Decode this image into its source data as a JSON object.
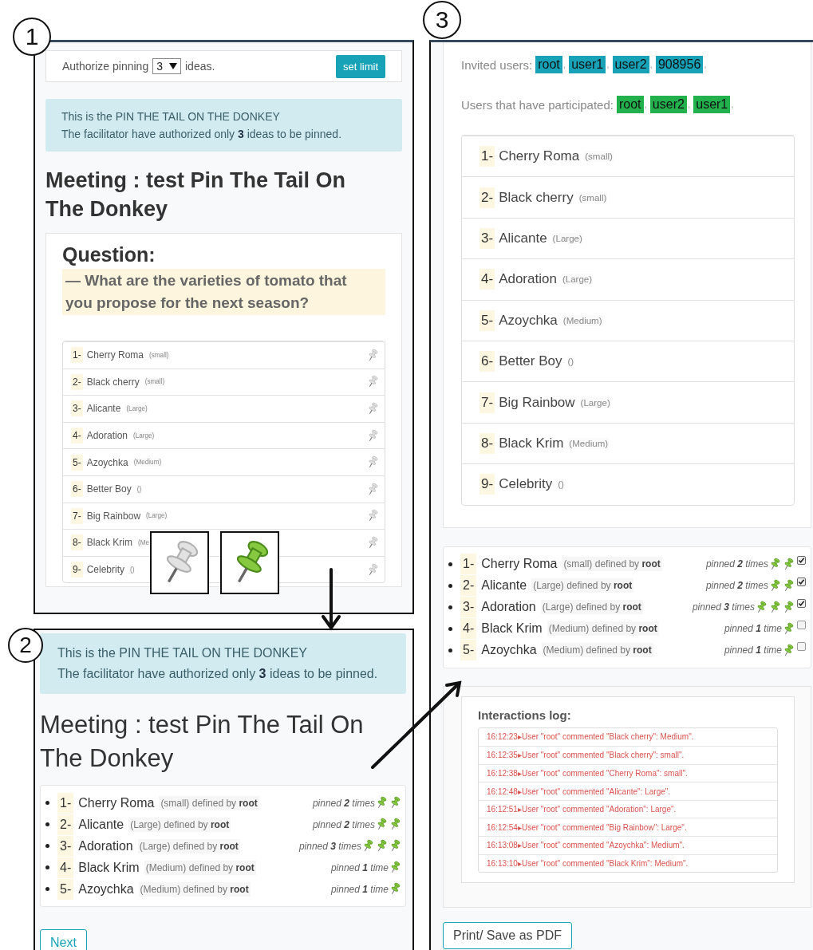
{
  "panel_1": {
    "marker": "1",
    "limit_bar": {
      "label": "Authorize pinning",
      "select_value": "3",
      "suffix": "ideas.",
      "button": "set limit"
    },
    "alert": {
      "lines": [
        "This is the PIN THE TAIL ON THE DONKEY",
        "The facilitator have authorized only **3** ideas to be pinned."
      ]
    },
    "title": "Meeting : test Pin The Tail On The Donkey",
    "question": {
      "heading": "Question:",
      "text": "— What are the varieties of tomato that you propose for the next season?"
    },
    "ideas": [
      {
        "number": "1-",
        "name": "Cherry Roma",
        "detail": "(small)"
      },
      {
        "number": "2-",
        "name": "Black cherry",
        "detail": "(small)"
      },
      {
        "number": "3-",
        "name": "Alicante",
        "detail": "(Large)"
      },
      {
        "number": "4-",
        "name": "Adoration",
        "detail": "(Large)"
      },
      {
        "number": "5-",
        "name": "Azoychka",
        "detail": "(Medium)"
      },
      {
        "number": "6-",
        "name": "Better Boy",
        "detail": "()"
      },
      {
        "number": "7-",
        "name": "Big Rainbow",
        "detail": "(Large)"
      },
      {
        "number": "8-",
        "name": "Black Krim",
        "detail": "(Me"
      },
      {
        "number": "9-",
        "name": "Celebrity",
        "detail": "()"
      }
    ],
    "legend": [
      {
        "kind": "unpinned"
      },
      {
        "kind": "pinned"
      }
    ]
  },
  "panel_2": {
    "marker": "2",
    "alert": {
      "lines": [
        "This is the PIN THE TAIL ON THE DONKEY",
        "The facilitator have authorized only **3** ideas to be pinned."
      ]
    },
    "title": "Meeting : test Pin The Tail On The Donkey",
    "results": [
      {
        "number": "1-",
        "name": "Cherry Roma",
        "detail": "(small) defined by **root**",
        "pin_count": "pinned **2** times",
        "pins": [
          {
            "kind": "pinned"
          },
          {
            "kind": "pinned"
          }
        ]
      },
      {
        "number": "2-",
        "name": "Alicante",
        "detail": "(Large) defined by **root**",
        "pin_count": "pinned **2** times",
        "pins": [
          {
            "kind": "pinned"
          },
          {
            "kind": "pinned"
          }
        ]
      },
      {
        "number": "3-",
        "name": "Adoration",
        "detail": "(Large) defined by **root**",
        "pin_count": "pinned **3** times",
        "pins": [
          {
            "kind": "pinned"
          },
          {
            "kind": "pinned"
          },
          {
            "kind": "pinned"
          }
        ]
      },
      {
        "number": "4-",
        "name": "Black Krim",
        "detail": "(Medium) defined by **root**",
        "pin_count": "pinned **1** time",
        "pins": [
          {
            "kind": "pinned"
          }
        ]
      },
      {
        "number": "5-",
        "name": "Azoychka",
        "detail": "(Medium) defined by **root**",
        "pin_count": "pinned **1** time",
        "pins": [
          {
            "kind": "pinned"
          }
        ]
      }
    ],
    "button": "Next"
  },
  "panel_3": {
    "marker": "3",
    "user_groups": [
      {
        "kind": "invited",
        "label": "Invited users:",
        "separator": ",",
        "users": [
          "root",
          "user1",
          "user2",
          "908956"
        ]
      },
      {
        "kind": "participated",
        "label": "Users that have participated:",
        "separator": ",",
        "users": [
          "root",
          "user2",
          "user1"
        ]
      }
    ],
    "ideas": [
      {
        "number": "1-",
        "name": "Cherry Roma",
        "detail": "(small)"
      },
      {
        "number": "2-",
        "name": "Black cherry",
        "detail": "(small)"
      },
      {
        "number": "3-",
        "name": "Alicante",
        "detail": "(Large)"
      },
      {
        "number": "4-",
        "name": "Adoration",
        "detail": "(Large)"
      },
      {
        "number": "5-",
        "name": "Azoychka",
        "detail": "(Medium)"
      },
      {
        "number": "6-",
        "name": "Better Boy",
        "detail": "()"
      },
      {
        "number": "7-",
        "name": "Big Rainbow",
        "detail": "(Large)"
      },
      {
        "number": "8-",
        "name": "Black Krim",
        "detail": "(Medium)"
      },
      {
        "number": "9-",
        "name": "Celebrity",
        "detail": "()"
      }
    ],
    "results": [
      {
        "number": "1-",
        "name": "Cherry Roma",
        "detail": "(small) defined by **root**",
        "pin_count": "pinned **2** times",
        "pins": [
          {
            "kind": "pinned"
          },
          {
            "kind": "pinned"
          }
        ],
        "checked": true
      },
      {
        "number": "2-",
        "name": "Alicante",
        "detail": "(Large) defined by **root**",
        "pin_count": "pinned **2** times",
        "pins": [
          {
            "kind": "pinned"
          },
          {
            "kind": "pinned"
          }
        ],
        "checked": true
      },
      {
        "number": "3-",
        "name": "Adoration",
        "detail": "(Large) defined by **root**",
        "pin_count": "pinned **3** times",
        "pins": [
          {
            "kind": "pinned"
          },
          {
            "kind": "pinned"
          },
          {
            "kind": "pinned"
          }
        ],
        "checked": true
      },
      {
        "number": "4-",
        "name": "Black Krim",
        "detail": "(Medium) defined by **root**",
        "pin_count": "pinned **1** time",
        "pins": [
          {
            "kind": "pinned"
          }
        ],
        "checked": false
      },
      {
        "number": "5-",
        "name": "Azoychka",
        "detail": "(Medium) defined by **root**",
        "pin_count": "pinned **1** time",
        "pins": [
          {
            "kind": "pinned"
          }
        ],
        "checked": false
      }
    ],
    "log": {
      "title": "Interactions log:",
      "entries": [
        "16:12:23▸User \"root\" commented \"Black cherry\": Medium\".",
        "16:12:35▸User \"root\" commented \"Black cherry\": small\".",
        "16:12:38▸User \"root\" commented \"Cherry Roma\": small\".",
        "16:12:48▸User \"root\" commented \"Alicante\": Large\".",
        "16:12:51▸User \"root\" commented \"Adoration\": Large\".",
        "16:12:54▸User \"root\" commented \"Big Rainbow\": Large\".",
        "16:13:08▸User \"root\" commented \"Azoychka\": Medium\".",
        "16:13:10▸User \"root\" commented \"Black Krim\": Medium\"."
      ]
    },
    "button": "Print/ Save as PDF"
  }
}
